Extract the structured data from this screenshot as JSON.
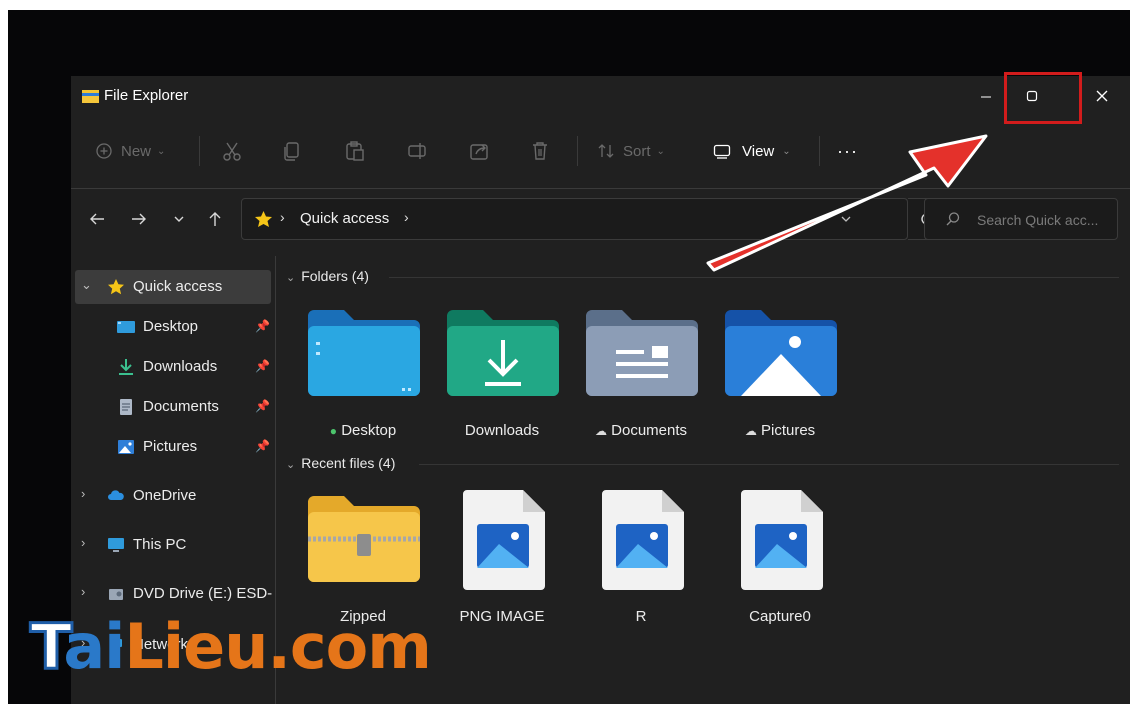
{
  "window": {
    "title": "File Explorer"
  },
  "toolbar": {
    "new_label": "New",
    "sort_label": "Sort",
    "view_label": "View",
    "more_label": "···"
  },
  "address": {
    "path": "Quick access",
    "search_placeholder": "Search Quick acc..."
  },
  "sidebar": {
    "quick_access": "Quick access",
    "items": [
      {
        "label": "Desktop",
        "icon": "desktop-icon",
        "pinned": true
      },
      {
        "label": "Downloads",
        "icon": "downloads-icon",
        "pinned": true
      },
      {
        "label": "Documents",
        "icon": "documents-icon",
        "pinned": true
      },
      {
        "label": "Pictures",
        "icon": "pictures-icon",
        "pinned": true
      }
    ],
    "onedrive": "OneDrive",
    "this_pc": "This PC",
    "dvd": "DVD Drive (E:) ESD-",
    "network": "Network"
  },
  "content": {
    "folders_header": "Folders (4)",
    "folders": [
      {
        "name": "Desktop",
        "status": "synced"
      },
      {
        "name": "Downloads",
        "status": ""
      },
      {
        "name": "Documents",
        "status": "cloud"
      },
      {
        "name": "Pictures",
        "status": "cloud"
      }
    ],
    "recent_header": "Recent files (4)",
    "recent": [
      {
        "name": "Zipped"
      },
      {
        "name": "PNG IMAGE"
      },
      {
        "name": "R"
      },
      {
        "name": "Capture0"
      }
    ]
  },
  "watermark": {
    "part1": "T",
    "part2": "ai",
    "part3": "Lieu.com"
  },
  "colors": {
    "highlight": "#d21c1c",
    "accent_folder": "#2f9bdc",
    "downloads_folder": "#1fa58a",
    "star": "#f5c518"
  }
}
